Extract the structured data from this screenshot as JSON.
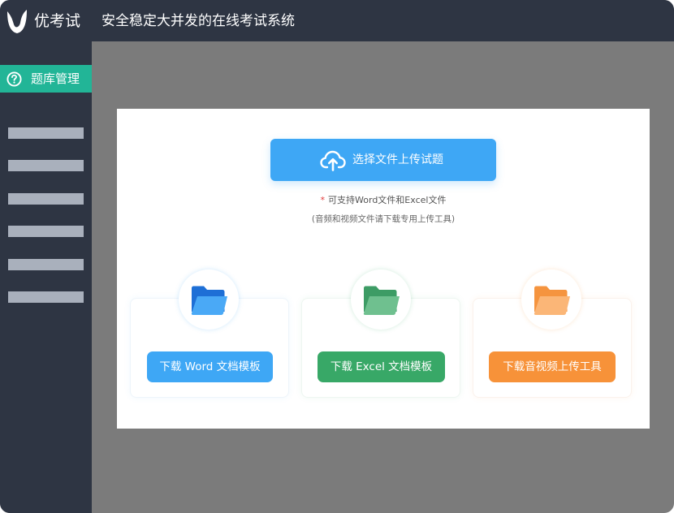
{
  "header": {
    "brand": "优考试",
    "slogan": "安全稳定大并发的在线考试系统"
  },
  "sidebar": {
    "active_item": {
      "label": "题库管理",
      "icon": "question-circle-icon"
    },
    "placeholder_item_count": 6
  },
  "upload": {
    "button_label": "选择文件上传试题",
    "icon": "cloud-upload-icon",
    "note_star": "*",
    "note": "可支持Word文件和Excel文件",
    "subnote": "(音频和视频文件请下载专用上传工具)"
  },
  "downloads": [
    {
      "label": "下载 Word 文档模板",
      "color": "#3ea7f5",
      "icon": "blue-folder-icon"
    },
    {
      "label": "下载 Excel 文档模板",
      "color": "#38a867",
      "icon": "green-folder-icon"
    },
    {
      "label": "下载音视频上传工具",
      "color": "#f79239",
      "icon": "orange-folder-icon"
    }
  ],
  "colors": {
    "topbar": "#2e3543",
    "accent": "#22b597",
    "overlay": "#7b7b7b"
  }
}
